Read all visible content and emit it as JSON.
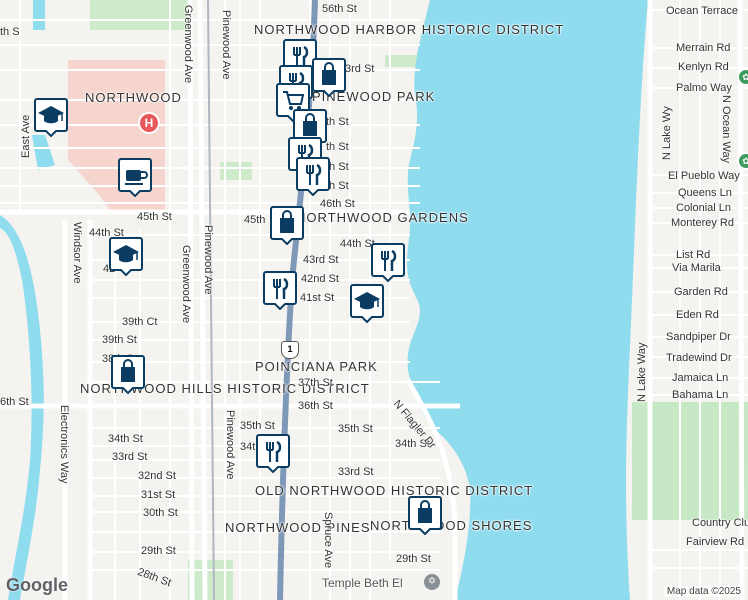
{
  "map": {
    "colors": {
      "land": "#f4f3f0",
      "water": "#8fdcee",
      "park": "#bfe3c0",
      "hospital": "#f2c8c0",
      "road": "#ffffff",
      "highway": "#7e98b8",
      "pin": "#0b3d62"
    },
    "neighborhoods": {
      "northwood_harbor": "NORTHWOOD HARBOR HISTORIC DISTRICT",
      "northwood": "NORTHWOOD",
      "pinewood_park": "PINEWOOD PARK",
      "northwood_gardens": "NORTHWOOD GARDENS",
      "poinciana_park": "POINCIANA PARK",
      "northwood_hills": "NORTHWOOD HILLS HISTORIC DISTRICT",
      "old_northwood": "OLD NORTHWOOD HISTORIC DISTRICT",
      "northwood_pines": "NORTHWOOD PINES",
      "northwood_shores": "NORTHWOOD SHORES"
    },
    "streets": {
      "s56": "56th St",
      "s45_left": "45th St",
      "s45_right": "45th",
      "s44_left": "44th St",
      "s44_right": "44th St",
      "s43": "43rd St",
      "s42": "42nd St",
      "s41": "41st St",
      "s39": "39th Ct",
      "s39b": "39th St",
      "s38": "38th St",
      "s37": "37th St",
      "s36": "36th St",
      "s35": "35th St",
      "s35b": "35th St",
      "s34": "34th St",
      "s34b": "34th St",
      "s34c": "34th",
      "s33": "33rd St",
      "s33b": "33rd St",
      "s32": "32nd St",
      "s31": "31st St",
      "s30": "30th St",
      "s29": "29th St",
      "s29b": "29th St",
      "s28": "28th St",
      "s46": "46th St",
      "s47": "th St",
      "s48": "th St",
      "s49": "th St",
      "s51": "th St",
      "s53": "3rd St",
      "s42left": "42",
      "greenwood1": "Greenwood Ave",
      "greenwood2": "Greenwood Ave",
      "pinewood1": "Pinewood Ave",
      "pinewood2": "Pinewood Ave",
      "pinewood3": "Pinewood Ave",
      "windsor": "Windsor Ave",
      "east": "East Ave",
      "electronics": "Electronics Way",
      "spruce": "Spruce Ave",
      "flagler": "N Flagler Dr",
      "lakeway1": "N Lake Wy",
      "lakeway2": "N Lake Way",
      "oceanway": "N Ocean Way",
      "th_s": "th S",
      "s36left": "6th St"
    },
    "right_streets": {
      "ocean_terrace": "Ocean Terrace",
      "merrain": "Merrain Rd",
      "kenlyn": "Kenlyn Rd",
      "palmo": "Palmo Way",
      "el_pueblo": "El Pueblo Way",
      "queens": "Queens Ln",
      "colonial": "Colonial Ln",
      "monterey": "Monterey Rd",
      "list": "List Rd",
      "via_marila": "Via Marila",
      "garden": "Garden Rd",
      "eden": "Eden Rd",
      "sandpiper": "Sandpiper Dr",
      "tradewind": "Tradewind Dr",
      "jamaica": "Jamaica Ln",
      "bahama": "Bahama Ln",
      "country_club": "Country Clu",
      "fairview": "Fairview Rd"
    },
    "poi": {
      "temple": "Temple Beth El",
      "route": "1"
    },
    "pins": [
      {
        "icon": "restaurant-icon"
      },
      {
        "icon": "restaurant-icon"
      },
      {
        "icon": "shopping-bag-icon"
      },
      {
        "icon": "shopping-cart-icon"
      },
      {
        "icon": "shopping-bag-icon"
      },
      {
        "icon": "restaurant-icon"
      },
      {
        "icon": "restaurant-icon"
      },
      {
        "icon": "school-icon"
      },
      {
        "icon": "cafe-icon"
      },
      {
        "icon": "shopping-bag-icon"
      },
      {
        "icon": "school-icon"
      },
      {
        "icon": "restaurant-icon"
      },
      {
        "icon": "restaurant-icon"
      },
      {
        "icon": "school-icon"
      },
      {
        "icon": "shopping-bag-icon"
      },
      {
        "icon": "restaurant-icon"
      },
      {
        "icon": "shopping-bag-icon"
      }
    ],
    "hospital_symbol": "H",
    "google": "Google",
    "attribution": "Map data ©2025"
  }
}
